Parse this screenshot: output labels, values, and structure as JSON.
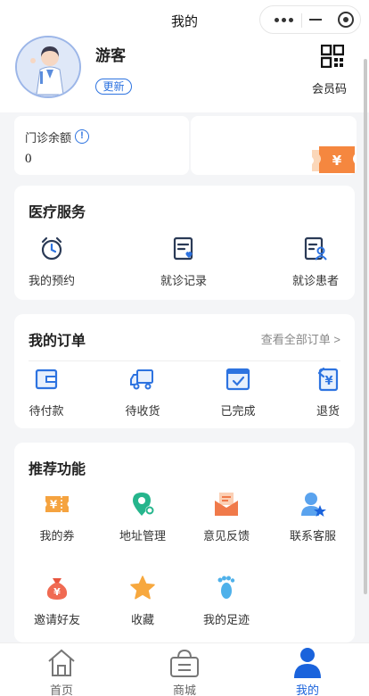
{
  "topbar": {
    "title": "我的"
  },
  "profile": {
    "name": "游客",
    "update_label": "更新",
    "qr_label": "会员码"
  },
  "balance": {
    "label": "门诊余额",
    "info_symbol": "!",
    "value": "0"
  },
  "banner": {
    "ticket_symbol": "¥"
  },
  "medical": {
    "title": "医疗服务",
    "items": [
      {
        "label": "我的预约",
        "icon": "alarm-clock-icon"
      },
      {
        "label": "就诊记录",
        "icon": "medical-record-icon"
      },
      {
        "label": "就诊患者",
        "icon": "patient-card-icon"
      }
    ]
  },
  "orders": {
    "title": "我的订单",
    "view_all": "查看全部订单 >",
    "items": [
      {
        "label": "待付款",
        "icon": "wallet-icon"
      },
      {
        "label": "待收货",
        "icon": "delivery-truck-icon"
      },
      {
        "label": "已完成",
        "icon": "completed-check-icon"
      },
      {
        "label": "退货",
        "icon": "refund-icon",
        "symbol": "¥"
      }
    ]
  },
  "recommend": {
    "title": "推荐功能",
    "items": [
      {
        "label": "我的券",
        "icon": "coupon-icon",
        "symbol": "¥"
      },
      {
        "label": "地址管理",
        "icon": "location-pin-icon"
      },
      {
        "label": "意见反馈",
        "icon": "feedback-mail-icon"
      },
      {
        "label": "联系客服",
        "icon": "customer-service-icon"
      },
      {
        "label": "邀请好友",
        "icon": "money-bag-icon",
        "symbol": "¥"
      },
      {
        "label": "收藏",
        "icon": "star-icon"
      },
      {
        "label": "我的足迹",
        "icon": "footprint-icon"
      }
    ]
  },
  "tabbar": {
    "tabs": [
      {
        "label": "首页",
        "icon": "home-icon"
      },
      {
        "label": "商城",
        "icon": "shopping-bag-icon"
      },
      {
        "label": "我的",
        "icon": "user-icon",
        "active": true
      }
    ]
  },
  "colors": {
    "accent": "#2d73e0",
    "tab_active": "#1a63dc",
    "orange": "#f5873f",
    "green": "#25b58c"
  }
}
